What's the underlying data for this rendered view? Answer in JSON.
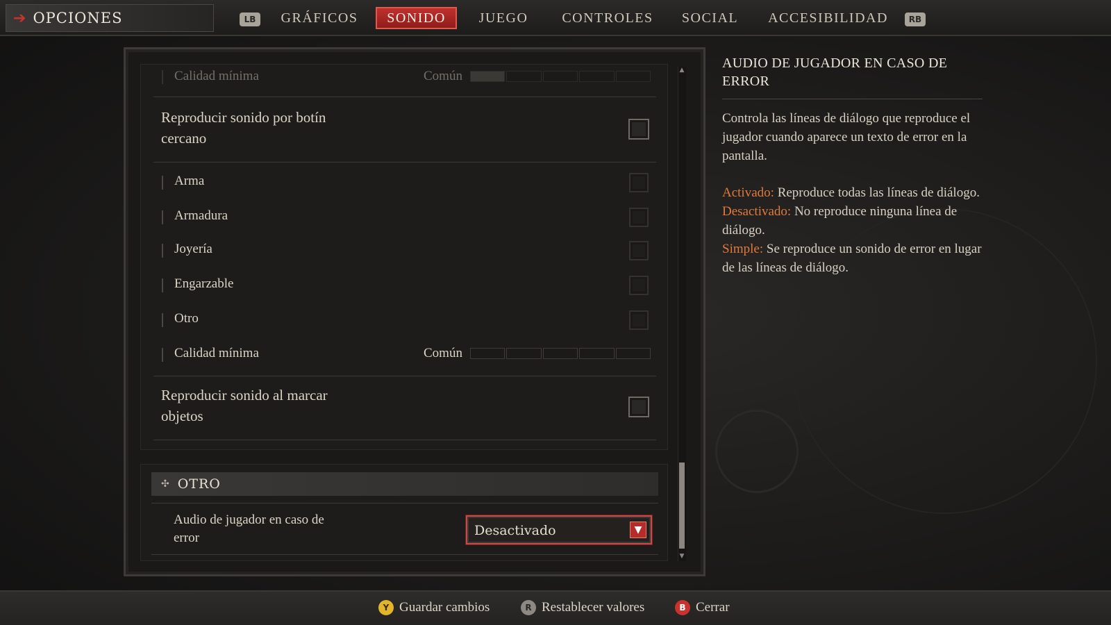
{
  "header": {
    "title": "OPCIONES",
    "lb_label": "LB",
    "rb_label": "RB",
    "tabs": [
      {
        "label": "GRÁFICOS",
        "active": false
      },
      {
        "label": "SONIDO",
        "active": true
      },
      {
        "label": "JUEGO",
        "active": false
      },
      {
        "label": "CONTROLES",
        "active": false
      },
      {
        "label": "SOCIAL",
        "active": false
      },
      {
        "label": "ACCESIBILIDAD",
        "active": false
      }
    ]
  },
  "settings": {
    "top_quality_label": "Calidad mínima",
    "top_quality_value": "Común",
    "loot_sound_label_line1": "Reproducir sonido por botín",
    "loot_sound_label_line2": "cercano",
    "loot_items": [
      {
        "label": "Arma",
        "checked": false
      },
      {
        "label": "Armadura",
        "checked": false
      },
      {
        "label": "Joyería",
        "checked": false
      },
      {
        "label": "Engarzable",
        "checked": false
      },
      {
        "label": "Otro",
        "checked": false
      }
    ],
    "min_quality_label": "Calidad mínima",
    "min_quality_value": "Común",
    "mark_sound_label_line1": "Reproducir sonido al marcar",
    "mark_sound_label_line2": "objetos"
  },
  "section_other": {
    "header": "OTRO",
    "error_audio_label_line1": "Audio de jugador en caso de",
    "error_audio_label_line2": "error",
    "error_audio_value": "Desactivado"
  },
  "description": {
    "title_line1": "AUDIO DE JUGADOR EN CASO DE",
    "title_line2": "ERROR",
    "body": "Controla las líneas de diálogo que reproduce el jugador cuando aparece un texto de error en la pantalla.",
    "options": [
      {
        "key": "Activado:",
        "text": " Reproduce todas las líneas de diálogo."
      },
      {
        "key": "Desactivado:",
        "text": " No reproduce ninguna línea de diálogo."
      },
      {
        "key": "Simple:",
        "text": " Se reproduce un sonido de error en lugar de las líneas de diálogo."
      }
    ]
  },
  "footer": {
    "save": {
      "button": "Y",
      "label": "Guardar cambios"
    },
    "reset": {
      "button": "R",
      "label": "Restablecer valores"
    },
    "close": {
      "button": "B",
      "label": "Cerrar"
    }
  },
  "colors": {
    "accent_red": "#c0302e",
    "highlight_orange": "#e07a3a",
    "y_button": "#e2b52a",
    "b_button": "#c8332e"
  }
}
